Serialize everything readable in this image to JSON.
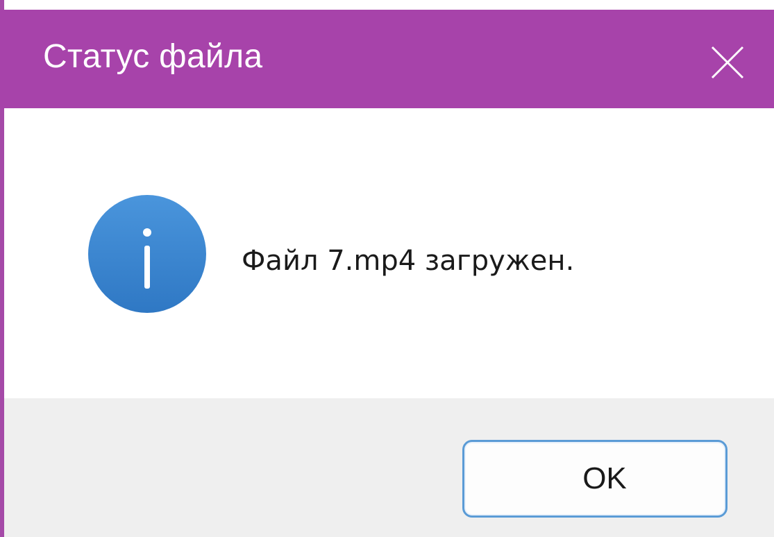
{
  "dialog": {
    "title": "Статус файла",
    "message": "Файл 7.mp4 загружен.",
    "ok_label": "OK",
    "icons": {
      "close": "close-icon",
      "info": "info-icon"
    }
  },
  "colors": {
    "titlebar": "#a743aa",
    "title_text": "#ffffff",
    "info_icon": "#3a86d1",
    "button_border": "#5a9bd6",
    "footer": "#efefef"
  }
}
